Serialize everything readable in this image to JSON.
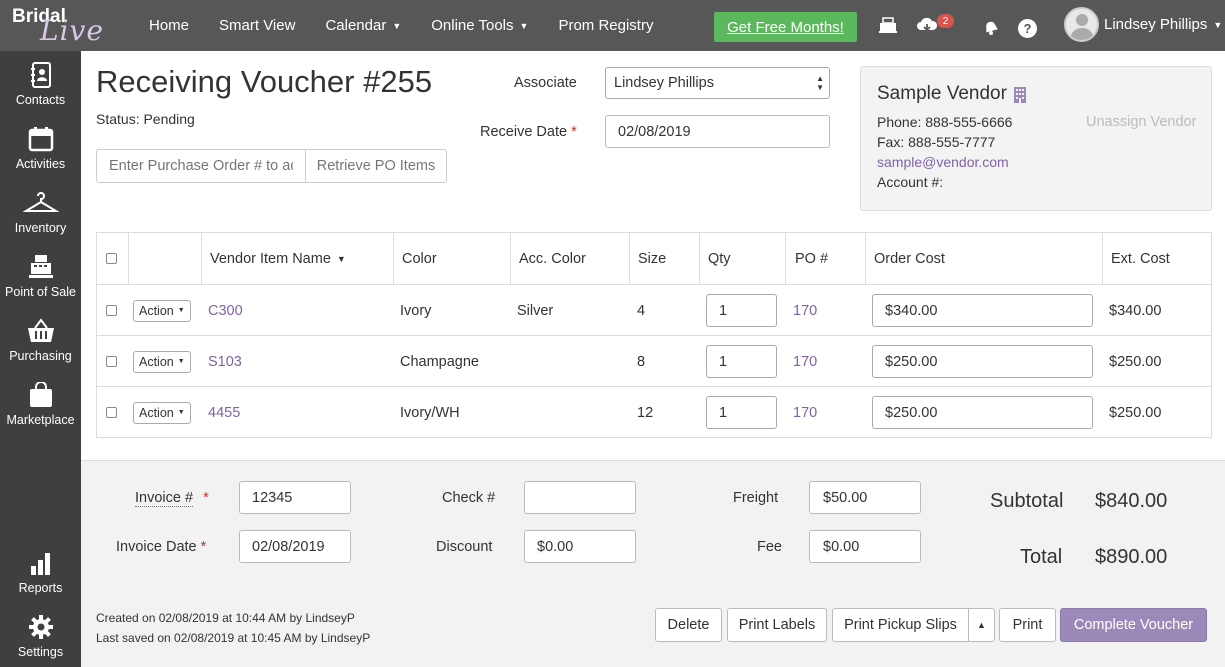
{
  "brand": {
    "line1": "Bridal",
    "line2": "Live"
  },
  "nav": {
    "items": [
      {
        "label": "Home",
        "dropdown": false
      },
      {
        "label": "Smart View",
        "dropdown": false
      },
      {
        "label": "Calendar",
        "dropdown": true
      },
      {
        "label": "Online Tools",
        "dropdown": true
      },
      {
        "label": "Prom Registry",
        "dropdown": false
      }
    ],
    "promo": "Get Free Months!",
    "notification_count": "2",
    "help": "?",
    "user_name": "Lindsey Phillips"
  },
  "sidebar": {
    "items": [
      {
        "label": "Contacts",
        "icon": "contacts-icon"
      },
      {
        "label": "Activities",
        "icon": "calendar-icon"
      },
      {
        "label": "Inventory",
        "icon": "hanger-icon"
      },
      {
        "label": "Point of Sale",
        "icon": "register-icon"
      },
      {
        "label": "Purchasing",
        "icon": "basket-icon"
      },
      {
        "label": "Marketplace",
        "icon": "bag-icon"
      },
      {
        "label": "Reports",
        "icon": "bar-chart-icon"
      },
      {
        "label": "Settings",
        "icon": "gear-icon"
      }
    ]
  },
  "voucher": {
    "title": "Receiving Voucher #255",
    "status": "Status: Pending",
    "po_placeholder": "Enter Purchase Order # to add items",
    "retrieve_label": "Retrieve PO Items",
    "associate_label": "Associate",
    "associate_value": "Lindsey Phillips",
    "receive_date_label": "Receive Date",
    "receive_date_value": "02/08/2019",
    "required_mark": "*"
  },
  "vendor": {
    "name": "Sample Vendor",
    "phone": "Phone: 888-555-6666",
    "fax": "Fax: 888-555-7777",
    "email": "sample@vendor.com",
    "account": "Account #:",
    "unassign": "Unassign Vendor"
  },
  "table": {
    "headers": {
      "name": "Vendor Item Name",
      "color": "Color",
      "acc_color": "Acc. Color",
      "size": "Size",
      "qty": "Qty",
      "po": "PO #",
      "order_cost": "Order Cost",
      "ext_cost": "Ext. Cost"
    },
    "action_label": "Action",
    "rows": [
      {
        "name": "C300",
        "color": "Ivory",
        "acc_color": "Silver",
        "size": "4",
        "qty": "1",
        "po": "170",
        "order_cost": "$340.00",
        "ext_cost": "$340.00"
      },
      {
        "name": "S103",
        "color": "Champagne",
        "acc_color": "",
        "size": "8",
        "qty": "1",
        "po": "170",
        "order_cost": "$250.00",
        "ext_cost": "$250.00"
      },
      {
        "name": "4455",
        "color": "Ivory/WH",
        "acc_color": "",
        "size": "12",
        "qty": "1",
        "po": "170",
        "order_cost": "$250.00",
        "ext_cost": "$250.00"
      }
    ]
  },
  "footer": {
    "invoice_label": "Invoice #",
    "invoice_value": "12345",
    "invoice_date_label": "Invoice Date",
    "invoice_date_value": "02/08/2019",
    "check_label": "Check #",
    "check_value": "",
    "discount_label": "Discount",
    "discount_value": "$0.00",
    "freight_label": "Freight",
    "freight_value": "$50.00",
    "fee_label": "Fee",
    "fee_value": "$0.00",
    "subtotal_label": "Subtotal",
    "subtotal_value": "$840.00",
    "total_label": "Total",
    "total_value": "$890.00",
    "created": "Created on 02/08/2019 at 10:44 AM by LindseyP",
    "saved": "Last saved on 02/08/2019 at 10:45 AM by LindseyP",
    "buttons": {
      "delete": "Delete",
      "print_labels": "Print Labels",
      "print_pickup": "Print Pickup Slips",
      "print": "Print",
      "complete": "Complete Voucher"
    }
  },
  "colors": {
    "nav_bg": "#575757",
    "sidebar_bg": "#3f3f3f",
    "accent": "#7e64a6",
    "promo": "#5cb85c",
    "primary_button": "#9b8ab9"
  }
}
